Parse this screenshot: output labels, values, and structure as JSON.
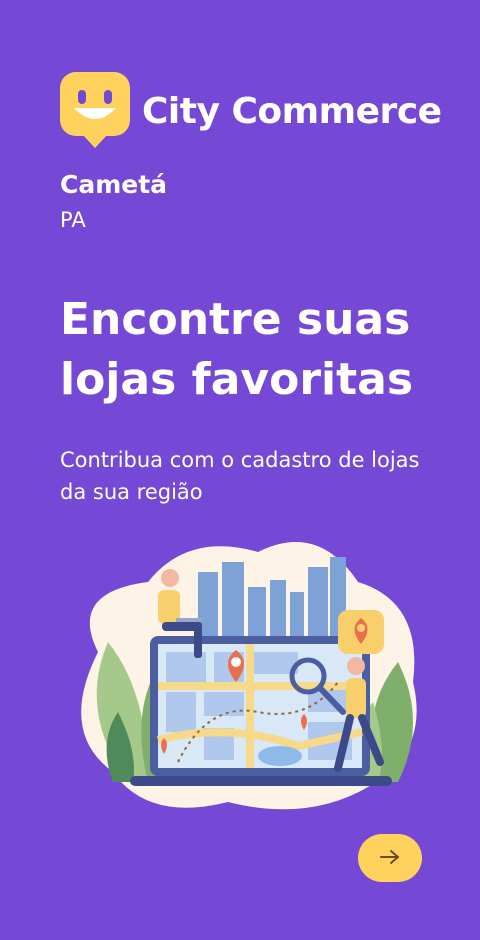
{
  "app": {
    "name": "City Commerce",
    "logo_icon": "smiley-chat-icon"
  },
  "location": {
    "city": "Cametá",
    "state": "PA"
  },
  "onboarding": {
    "headline": "Encontre suas lojas favoritas",
    "subtitle": "Contribua com o cadastro de lojas da sua região",
    "illustration": "city-map-illustration",
    "next_icon": "arrow-right-icon"
  },
  "colors": {
    "background": "#7549D6",
    "accent": "#FFD25E",
    "text": "#FFFFFF",
    "pin": "#E8704E"
  }
}
